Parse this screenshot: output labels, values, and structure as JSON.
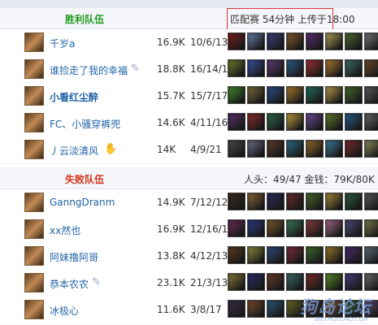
{
  "winning_team": {
    "title": "胜利队伍",
    "match_info": "匹配赛  54分钟  上传于18:00",
    "players": [
      {
        "name": "千岁a",
        "gold": "16.9K",
        "kda": "10/6/13",
        "items": [
          "#7a1d1d",
          "#6a7ea8",
          "#3b3f7d",
          "#8a5a2b",
          "#5a2f6e",
          "#b6a25a",
          "#4b6a2e",
          "#777"
        ]
      },
      {
        "name": "谁捡走了我的幸福",
        "gold": "18.8K",
        "kda": "16/14/19",
        "items": [
          "#6f7a2a",
          "#3a53a8",
          "#5e3b78",
          "#2c5e8a",
          "#a22f2f",
          "#b17a2f",
          "#3b6f6a",
          "#6d4a2b"
        ]
      },
      {
        "name": "小看红尘醉",
        "gold": "15.7K",
        "kda": "15/7/17",
        "items": [
          "#3f8a2a",
          "#7a6b3a",
          "#2a4f8a",
          "#a87a2a",
          "#1f6e5a",
          "#b79a4a",
          "#456a2a",
          "#5a5a5a"
        ]
      },
      {
        "name": "FC、小骚穿裤兜",
        "gold": "14.6K",
        "kda": "4/11/16",
        "items": [
          "#5a2f6e",
          "#8a2a2a",
          "#2d6a4a",
          "#c0a040",
          "#6f4b9a",
          "#5e7a2a",
          "#2a5a8a",
          "#666"
        ]
      },
      {
        "name": "丿云淡清风",
        "gold": "14K",
        "kda": "4/9/21",
        "items": [
          "#4a4a4a",
          "#6e6e8a",
          "#5a3a2a",
          "#2a6e8a",
          "#9a6a2a",
          "#3a7a9a",
          "#7a2a2a",
          "#8a8a5a"
        ]
      }
    ]
  },
  "losing_team": {
    "title": "失败队伍",
    "stats_info": "人头：49/47  金钱：79K/80K",
    "players": [
      {
        "name": "GanngDranm",
        "gold": "14.9K",
        "kda": "7/12/12",
        "items": [
          "#3a2a1a",
          "#8a6a3a",
          "#2a2a5a",
          "#6a2a2a",
          "#4a6a2a",
          "#a88a3a",
          "#2a5a3a",
          "#5a5a5a"
        ]
      },
      {
        "name": "xx然也",
        "gold": "16.9K",
        "kda": "12/16/16",
        "items": [
          "#6a2a5a",
          "#2a3a8a",
          "#7a5a2a",
          "#3a7a5a",
          "#8a3a3a",
          "#a66a8a",
          "#4a4a7a",
          "#7a7a4a"
        ]
      },
      {
        "name": "阿妹撸阿哥",
        "gold": "13.8K",
        "kda": "4/12/13",
        "items": [
          "#5a3a1a",
          "#8a8a3a",
          "#2a4a7a",
          "#7a2a3a",
          "#3a6a2a",
          "#9a7a2a",
          "#4a2a6a",
          "#5a6a7a"
        ]
      },
      {
        "name": "恭本农农",
        "gold": "23.1K",
        "kda": "21/3/13",
        "items": [
          "#8a7a3a",
          "#2a2a6a",
          "#6a3a2a",
          "#3a6a6a",
          "#7a2a2a",
          "#5a8a2a",
          "#4a3a7a",
          "#6a6a6a"
        ]
      },
      {
        "name": "冰极心",
        "gold": "11.6K",
        "kda": "3/8/17",
        "items": [
          "#3a2a4a",
          "#7a4a2a",
          "#2a5a7a",
          "#6a6a2a",
          "#4a2a2a",
          "#8a5a3a",
          "#3a5a3a",
          "#5a4a6a"
        ]
      }
    ]
  },
  "watermark": {
    "main": "狗岛论坛",
    "sub": "BBS.HOUDAO.COM"
  }
}
